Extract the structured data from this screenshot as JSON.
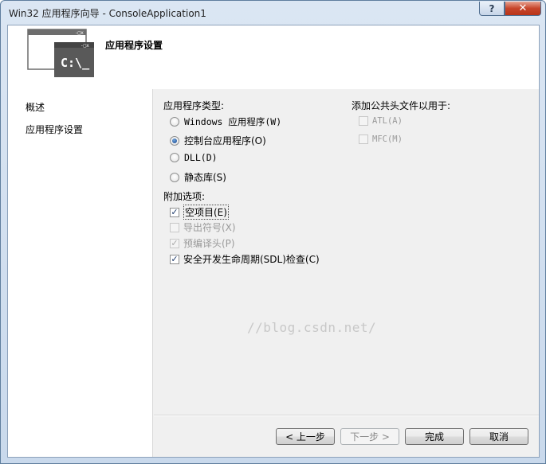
{
  "window": {
    "title": "Win32 应用程序向导 - ConsoleApplication1",
    "help_label": "?",
    "close_label": "✕"
  },
  "header": {
    "title": "应用程序设置",
    "icon_text": "C:\\_"
  },
  "nav": {
    "items": [
      {
        "label": "概述"
      },
      {
        "label": "应用程序设置"
      }
    ]
  },
  "app_type": {
    "label": "应用程序类型:",
    "options": [
      {
        "label": "Windows 应用程序(W)",
        "selected": false
      },
      {
        "label": "控制台应用程序(O)",
        "selected": true
      },
      {
        "label": "DLL(D)",
        "selected": false
      },
      {
        "label": "静态库(S)",
        "selected": false
      }
    ]
  },
  "common_headers": {
    "label": "添加公共头文件以用于:",
    "options": [
      {
        "label": "ATL(A)",
        "checked": false,
        "enabled": false
      },
      {
        "label": "MFC(M)",
        "checked": false,
        "enabled": false
      }
    ]
  },
  "extra_options": {
    "label": "附加选项:",
    "options": [
      {
        "label": "空项目(E)",
        "checked": true,
        "enabled": true
      },
      {
        "label": "导出符号(X)",
        "checked": false,
        "enabled": false
      },
      {
        "label": "预编译头(P)",
        "checked": true,
        "enabled": false
      },
      {
        "label": "安全开发生命周期(SDL)检查(C)",
        "checked": true,
        "enabled": true
      }
    ]
  },
  "watermark": "//blog.csdn.net/",
  "buttons": {
    "prev": "< 上一步",
    "next": "下一步 >",
    "finish": "完成",
    "cancel": "取消"
  }
}
